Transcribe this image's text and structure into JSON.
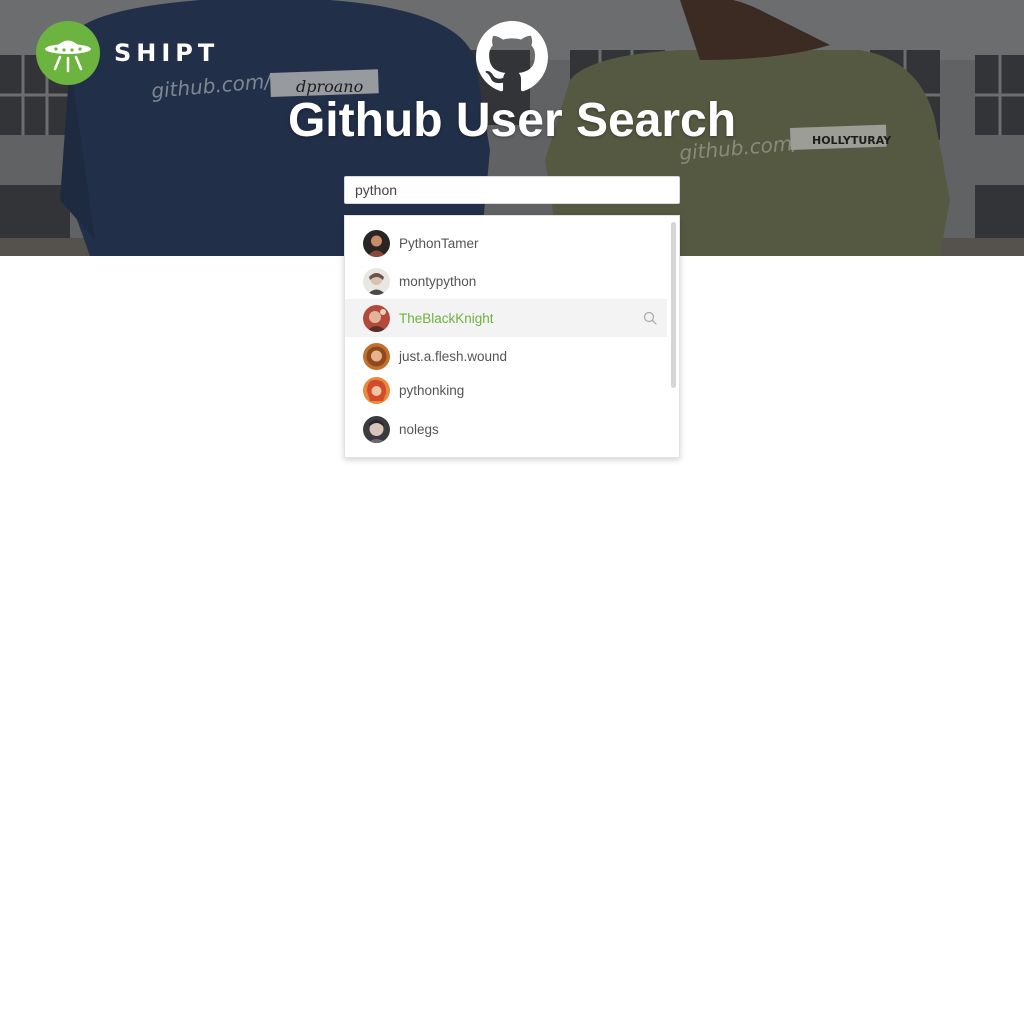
{
  "header": {
    "brand_name": "SHIPT",
    "brand_logo_icon": "ufo-icon",
    "brand_color": "#6cb33f",
    "github_icon": "github-octocat-icon",
    "title": "Github User Search"
  },
  "search": {
    "value": "python"
  },
  "suggestions": [
    {
      "label": "PythonTamer",
      "avatar_color": "#8a4a3a",
      "active": false
    },
    {
      "label": "montypython",
      "avatar_color": "#d8d4d0",
      "active": false
    },
    {
      "label": "TheBlackKnight",
      "avatar_color": "#b14a3c",
      "active": true
    },
    {
      "label": "just.a.flesh.wound",
      "avatar_color": "#c2702e",
      "active": false
    },
    {
      "label": "pythonking",
      "avatar_color": "#d24b2a",
      "active": false
    },
    {
      "label": "nolegs",
      "avatar_color": "#6a6a70",
      "active": false
    }
  ],
  "colors": {
    "accent": "#6cb33f",
    "text": "#555555",
    "active_row": "#f3f3f3"
  }
}
